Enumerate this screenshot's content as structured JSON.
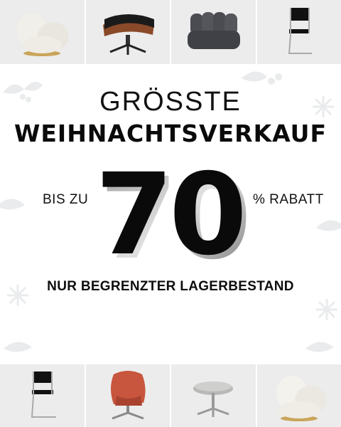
{
  "headline": {
    "line1": "GRÖSSTE",
    "line2": "WEIHNACHTSVERKAUF"
  },
  "offer": {
    "prefix": "BIS ZU",
    "value": "70",
    "suffix": "% RABATT"
  },
  "footnote": "NUR BEGRENZTER LAGERBESTAND",
  "products_top": [
    {
      "icon": "boucle-lounge-chair-icon"
    },
    {
      "icon": "leather-ottoman-icon"
    },
    {
      "icon": "modular-sofa-chair-icon"
    },
    {
      "icon": "cantilever-chair-icon"
    }
  ],
  "products_bottom": [
    {
      "icon": "cantilever-chair-icon"
    },
    {
      "icon": "egg-chair-icon"
    },
    {
      "icon": "swivel-ottoman-icon"
    },
    {
      "icon": "boucle-lounge-chair-icon"
    }
  ],
  "colors": {
    "tile_background": "#ececec",
    "text": "#111111",
    "accent_leather": "#c8553d",
    "decor": "#d8dcde"
  }
}
